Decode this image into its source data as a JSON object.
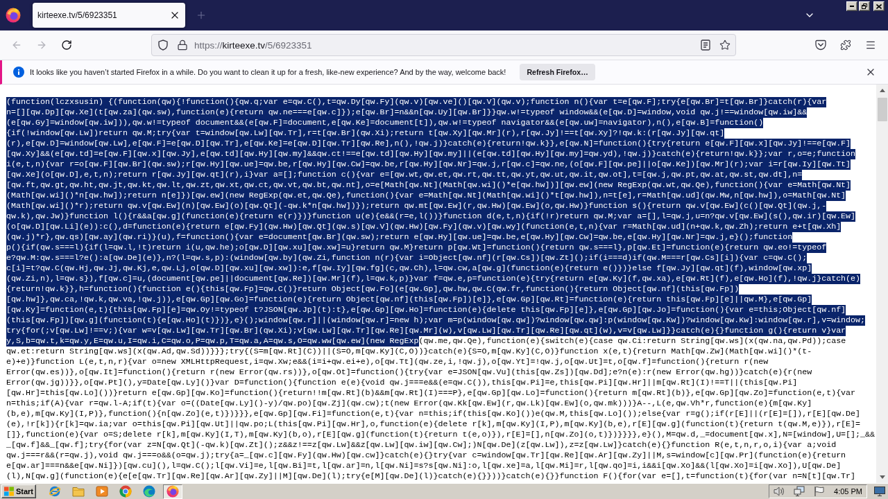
{
  "tabs": [
    {
      "title": "kirteexe.tv/5/6923351",
      "selected": true
    }
  ],
  "toolbar": {
    "nav_buttons": [
      {
        "kind": "back",
        "disabled": true
      },
      {
        "kind": "forward",
        "disabled": true
      },
      {
        "kind": "reload",
        "disabled": false
      }
    ],
    "url": {
      "scheme": "https://",
      "host": "kirteexe.tv",
      "path": "/5/6923351"
    }
  },
  "notification": {
    "message": "It looks like you haven’t started Firefox in a while. Do you want to clean it up for a fresh, like-new experience? And by the way, welcome back!",
    "button": "Refresh Firefox…"
  },
  "document": {
    "lines": [
      {
        "runs": [
          {
            "text": "(function(lczxsusin) {(function(qw){!function(){qw.q;var e=qw.C(),t=qw.Dy[qw.Fy](qw.v)[qw.ve]()[qw.V](qw.v);function n(){var t=e[qw.F];try{e[qw.Br]=t[qw.Br]}catch(r){var",
            "selected": true
          }
        ]
      },
      {
        "runs": [
          {
            "text": "n=[][qw.Dp][qw.Xe](t[qw.za](qw.sw),function(e){return qw.ne===e[qw.c]});e[qw.Br]=n&&n[qw.Uy][qw.Br]}}qw.w!=typeof window&&(e[qw.D]=window,void qw.j!==window[qw.iw]&&",
            "selected": true
          }
        ]
      },
      {
        "runs": [
          {
            "text": "(e[qw.Gy]=window[qw.iw])),qw.w!=typeof document&&(e[qw.F]=document,e[qw.Ke]=document[t]),qw.w!=typeof navigator&&(e[qw.uw]=navigator),n(),e[qw.B]=function()",
            "selected": true
          }
        ]
      },
      {
        "runs": [
          {
            "text": "{if(!window[qw.Lw])return qw.M;try{var t=window[qw.Lw][qw.Tr],r=t[qw.Br](qw.Xi);return t[qw.Xy][qw.Mr](r),r[qw.Jy]!==t[qw.Xy]?!qw.k:(r[qw.Jy][qw.qt]",
            "selected": true
          }
        ]
      },
      {
        "runs": [
          {
            "text": "(r),e[qw.D]=window[qw.Lw],e[qw.F]=e[qw.D][qw.Tr],e[qw.Ke]=e[qw.D][qw.Tr][qw.Re],n(),!qw.j)}catch(e){return!qw.k}},e[qw.N]=function(){try{return e[qw.F][qw.x][qw.Jy]!==e[qw.F]",
            "selected": true
          }
        ]
      },
      {
        "runs": [
          {
            "text": "[qw.Xy]&&(e[qw.td]=e[qw.F][qw.x][qw.Jy],e[qw.td][qw.Hy][qw.my]&&qw.ct!==e[qw.td][qw.Hy][qw.my]||(e[qw.td][qw.Hy][qw.my]=qw.yd),!qw.j)}catch(e){return!qw.k}};var r,o=e;function",
            "selected": true
          }
        ]
      },
      {
        "runs": [
          {
            "text": "i(e,t,n){var r=o[qw.F][qw.Br](qw.sw);r[qw.Hy][qw.ue]=qw.be,r[qw.Hy][qw.Cw]=qw.be,r[qw.Hy][qw.Nr]=qw.j,r[qw.c]=qw.ne,(o[qw.F][qw.pe]||o[qw.Ke])[qw.Mr](r);var i=r[qw.Iy][qw.Tt]",
            "selected": true
          }
        ]
      },
      {
        "runs": [
          {
            "text": "[qw.Xe](o[qw.D],e,t,n);return r[qw.Jy][qw.qt](r),i}var a=[];function c(){var e=[qw.wt,qw.et,qw.rt,qw.tt,qw.yt,qw.ut,qw.it,qw.ot],t=[qw.j,qw.pt,qw.at,qw.st,qw.dt],n=",
            "selected": true
          }
        ]
      },
      {
        "runs": [
          {
            "text": "[qw.ft,qw.gt,qw.ht,qw.jt,qw.kt,qw.lt,qw.zt,qw.xt,qw.ct,qw.vt,qw.bt,qw.nt],o=e[Math[qw.Nt](Math[qw.wi]()*e[qw.hw])][qw.ew](new RegExp(qw.wt,qw.Qe),function(){var e=Math[qw.Nt]",
            "selected": true
          }
        ]
      },
      {
        "runs": [
          {
            "text": "(Math[qw.wi]()*n[qw.hw]);return n[e]})[qw.ew](new RegExp(qw.et,qw.Qe),function(){var e=Math[qw.Nt](Math[qw.wi]()*t[qw.hw]),n=t[e],r=Math[qw.ud](qw.Mw,n[qw.hw]),o=Math[qw.Nt]",
            "selected": true
          }
        ]
      },
      {
        "runs": [
          {
            "text": "(Math[qw.wi]()*r);return qw.v[qw.Ew](n)[qw.Ew](o)[qw.Qt](-qw.k*n[qw.hw])});return qw.mt[qw.Ew](r,qw.Hw)[qw.Ew](o,qw.Hw)}function s(){return qw.v[qw.Ew](c()[qw.Qt](qw.j,-",
            "selected": true
          }
        ]
      },
      {
        "runs": [
          {
            "text": "qw.k),qw.Jw)}function l(){r&&a[qw.g](function(e){return e(r)})}function u(e){e&&(r=e,l())}function d(e,t,n){if(!r)return qw.M;var a=[],l=qw.j,u=n?qw.v[qw.Ew](s(),qw.ir)[qw.Ew]",
            "selected": true
          }
        ]
      },
      {
        "runs": [
          {
            "text": "(o[qw.D][qw.Li](e)):c(),d=function(e){return e[qw.Fy](qw.Hw)[qw.Qt](qw.s)[qw.V](qw.Hw)[qw.Fy](qw.v)[qw.wy](function(e,t,n){var r=Math[qw.ud](n+qw.k,qw.Zh);return e+t[qw.Xh]",
            "selected": true
          }
        ]
      },
      {
        "runs": [
          {
            "text": "(qw.j)*r},qw.qs)[qw.ay](qw.ri)}(u),f=function(){var e=document[qw.Br](qw.sw);return e[qw.Hy][qw.ue]=qw.be,e[qw.Hy][qw.Cw]=qw.be,e[qw.Hy][qw.Nr]=qw.j,e}();function",
            "selected": true
          }
        ]
      },
      {
        "runs": [
          {
            "text": "p(){if(qw.s===l){if(l=qw.l,!t)return i(u,qw.he);o[qw.D][qw.xu][qw.xw]=u}return qw.M}return p[qw.Wt]=function(){return qw.s===l},p[qw.Et]=function(e){return qw.eo!=typeof",
            "selected": true
          }
        ]
      },
      {
        "runs": [
          {
            "text": "e?qw.M:qw.s===l?e():a[qw.De](e)},n?(l=qw.s,p):(window[qw.by](qw.Zi,function n(r){var i=Object[qw.nf](r[qw.Cs])[qw.Zt]();if(i===d)if(qw.M===r[qw.Cs][i]){var c=qw.C();",
            "selected": true
          }
        ]
      },
      {
        "runs": [
          {
            "text": "c[i]=t?qw.C(qw.Hj,qw.Jj,qw.Kj,e,qw.Lj,o[qw.D][qw.xu][qw.xw]):e,f[qw.Iy][qw.fg](c,qw.Ch),l=qw.cw,a[qw.g](function(e){return e()})}else f[qw.Jy][qw.qt](f),window[qw.xp]",
            "selected": true
          }
        ]
      },
      {
        "runs": [
          {
            "text": "(qw.Zi,n),l=qw.s}),f[qw.c]=u,(document[qw.pe]||document[qw.Re])[qw.Mr](f),l=qw.k,p)}var f=qw.e,p=function(e){try{return e[qw.Ky](f,qw.xa),e[qw.Rt](f),e[qw.Ho](f),!qw.j}catch(e)",
            "selected": true
          }
        ]
      },
      {
        "runs": [
          {
            "text": "{return!qw.k}},h=function(){function e(){this[qw.Fp]=qw.C()}return Object[qw.Fo](e[qw.Gp],qw.hw,qw.C(qw.fr,function(){return Object[qw.nf](this[qw.Fp])",
            "selected": true
          }
        ]
      },
      {
        "runs": [
          {
            "text": "[qw.hw]},qw.ca,!qw.k,qw.va,!qw.j)),e[qw.Gp][qw.Go]=function(e){return Object[qw.nf](this[qw.Fp])[e]},e[qw.Gp][qw.Rt]=function(e){return this[qw.Fp][e]||qw.M},e[qw.Gp]",
            "selected": true
          }
        ]
      },
      {
        "runs": [
          {
            "text": "[qw.Ky]=function(e,t){this[qw.Fp][e]=qw.Oy!=typeof t?JSON[qw.Jp](t):t},e[qw.Gp][qw.Ho]=function(e){delete this[qw.Fp][e]},e[qw.Gp][qw.Jo]=function(){var e=this;Object[qw.nf]",
            "selected": true
          }
        ]
      },
      {
        "runs": [
          {
            "text": "(this[qw.Fp])[qw.g](function(t){e[qw.Ho](t)})},e}();window[qw.r]||(window[qw.r]=new h);var m=p(window[qw.qw])?window[qw.qw]:p(window[qw.Kw])?window[qw.Kw]:window[qw.r],v=window;",
            "selected": true
          }
        ]
      },
      {
        "runs": [
          {
            "text": "try{for(;v[qw.Lw]!==v;){var w=v[qw.Lw][qw.Tr][qw.Br](qw.Xi);v[qw.Lw][qw.Tr][qw.Re][qw.Mr](w),v[qw.Lw][qw.Tr][qw.Re][qw.qt](w),v=v[qw.Lw]}}catch(e){}function g(){return v}var",
            "selected": true
          }
        ]
      },
      {
        "runs": [
          {
            "text": "y,S,b=qw.t,k=qw.y,E=qw.u,I=qw.i,C=qw.o,P=qw.p,T=qw.a,A=qw.s,O=qw.ww[qw.ew](new RegExp",
            "selected": true
          },
          {
            "text": "(qw.me,qw.Qe),function(e){switch(e){case qw.Ci:return String[qw.ws](x(qw.na,qw.Pd));case",
            "selected": false
          }
        ]
      },
      {
        "runs": [
          {
            "text": "qw.et:return String[qw.ws](x(qw.Ad,qw.Sd))}}};try{(S=m[qw.Rt](C))||(S=O,m[qw.Ky](C,O))}catch(e){S=O,m[qw.Ky](C,O)}function x(e,t){return Math[qw.Zw](Math[qw.wi]()*(t-",
            "selected": false
          }
        ]
      },
      {
        "runs": [
          {
            "text": "e)+e)}function L(e,t,n,r){var o=new XMLHttpRequest,i=qw.Xw;e&&(i=i+qw.ei+e),o[qw.Tt](qw.ze,i,!qw.j),o[qw.Yt]=!qw.j,o[qw.Ut]=t,o[qw.f]=function(){return r(new",
            "selected": false
          }
        ]
      },
      {
        "runs": [
          {
            "text": "Error(qw.es))},o[qw.It]=function(){return r(new Error(qw.rs))},o[qw.Ot]=function(){try{var e=JSON[qw.Vu](this[qw.Zs])[qw.Dd];e?n(e):r(new Error(qw.hg))}catch(e){r(new",
            "selected": false
          }
        ]
      },
      {
        "runs": [
          {
            "text": "Error(qw.jg))}},o[qw.Pt](),y=Date[qw.Ly]()}var D=function(){function e(e){void qw.j===e&&(e=qw.C()),this[qw.Pi]=e,this[qw.Pi][qw.Hr]||m[qw.Rt](I)!==T||(this[qw.Pi]",
            "selected": false
          }
        ]
      },
      {
        "runs": [
          {
            "text": "[qw.Hr]=this[qw.Lo]())}return e[qw.Gp][qw.Ko]=function(){return!!m[qw.Rt](b)&&m[qw.Rt](I)===P},e[qw.Gp][qw.Lo]=function(){return m[qw.Rt](b)},e[qw.Gp][qw.Zo]=function(e,t){var",
            "selected": false
          }
        ]
      },
      {
        "runs": [
          {
            "text": "n=this;if(A){var r=qw.l-A;if(t){var o=((Date[qw.Ly]()-y)/qw.po)[qw.Zj](qw.cw);t(new Error(qw.Kk[qw.Ew](r,qw.Lk)[qw.Ew](o,qw.mk)))}A--,L(e,qw.Vh*r,function(e){m[qw.Ky]",
            "selected": false
          }
        ]
      },
      {
        "runs": [
          {
            "text": "(b,e),m[qw.Ky](I,P)},function(){n[qw.Zo](e,t)})}}},e[qw.Gp][qw.Fi]=function(e,t){var n=this;if(this[qw.Ko]())e(qw.M,this[qw.Lo]());else{var r=g();if(r[E]||(r[E]=[]),r[E][qw.De]",
            "selected": false
          }
        ]
      },
      {
        "runs": [
          {
            "text": "(e),!r[k]){r[k]=qw.ia;var o=this[qw.Pi][qw.Ut]||qw.po;L(this[qw.Pi][qw.Hr],o,function(e){delete r[k],m[qw.Ky](I,P),m[qw.Ky](b,e),r[E][qw.g](function(t){return t(qw.M,e)}),r[E]=",
            "selected": false
          }
        ]
      },
      {
        "runs": [
          {
            "text": "[]},function(e){var o=S;delete r[k],m[qw.Ky](I,T),m[qw.Ky](b,o),r[E][qw.g](function(t){return t(e,o)}),r[E]=[],n[qw.Zo](o,t)})}}}},e}(),M=qw.d,_=document[qw.x],N=[window],U=[];_&&",
            "selected": false
          }
        ]
      },
      {
        "runs": [
          {
            "text": "_[qw.f]&&_[qw.f];try{for(var z=N[qw.Qt](-qw.k)[qw.Zt]();z&&z!==z[qw.Lw]&&z[qw.Lw][qw.iw][qw.Cw];)N[qw.De](z[qw.Lw]),z=z[qw.Lw]}catch(e){}function R(e,t,n,r,o,i){var a;void",
            "selected": false
          }
        ]
      },
      {
        "runs": [
          {
            "text": "qw.j===r&&(r=qw.j),void qw.j===o&&(o=qw.j);try{a=_[qw.c][qw.Fy](qw.Hw)[qw.cw]}catch(e){}try{var c=window[qw.Tr][qw.Re][qw.Ar][qw.Zy]||M,s=window[c][qw.Pr](function(e){return",
            "selected": false
          }
        ]
      },
      {
        "runs": [
          {
            "text": "e[qw.ar]===n&&e[qw.Ni]})[qw.cu](),l=qw.C();l[qw.Vi]=e,l[qw.Bi]=t,l[qw.ar]=n,l[qw.Ni]=s?s[qw.Ni]:o,l[qw.xe]=a,l[qw.Mi]=r,l[qw.qo]=i,i&&i[qw.Xo]&&(l[qw.Xo]=i[qw.Xo]),U[qw.De]",
            "selected": false
          }
        ]
      },
      {
        "runs": [
          {
            "text": "(l),N[qw.g](function(e){e[e[qw.Tr][qw.Re][qw.Ar][qw.Zy]||M][qw.De](l);try{e[M][qw.De](l)}catch(e){}}))}catch(e){}}function F(){for(var e=[],t=function(t){for(var n=N[t][qw.Tr]",
            "selected": false
          }
        ]
      }
    ]
  },
  "taskbar": {
    "start": "Start",
    "apps": [
      {
        "kind": "ie",
        "selected": false
      },
      {
        "kind": "folder",
        "selected": false
      },
      {
        "kind": "media",
        "selected": false
      },
      {
        "kind": "chrome",
        "selected": false
      },
      {
        "kind": "edge",
        "selected": false
      },
      {
        "kind": "firefox",
        "selected": true
      }
    ],
    "clock": "4:05 PM"
  }
}
